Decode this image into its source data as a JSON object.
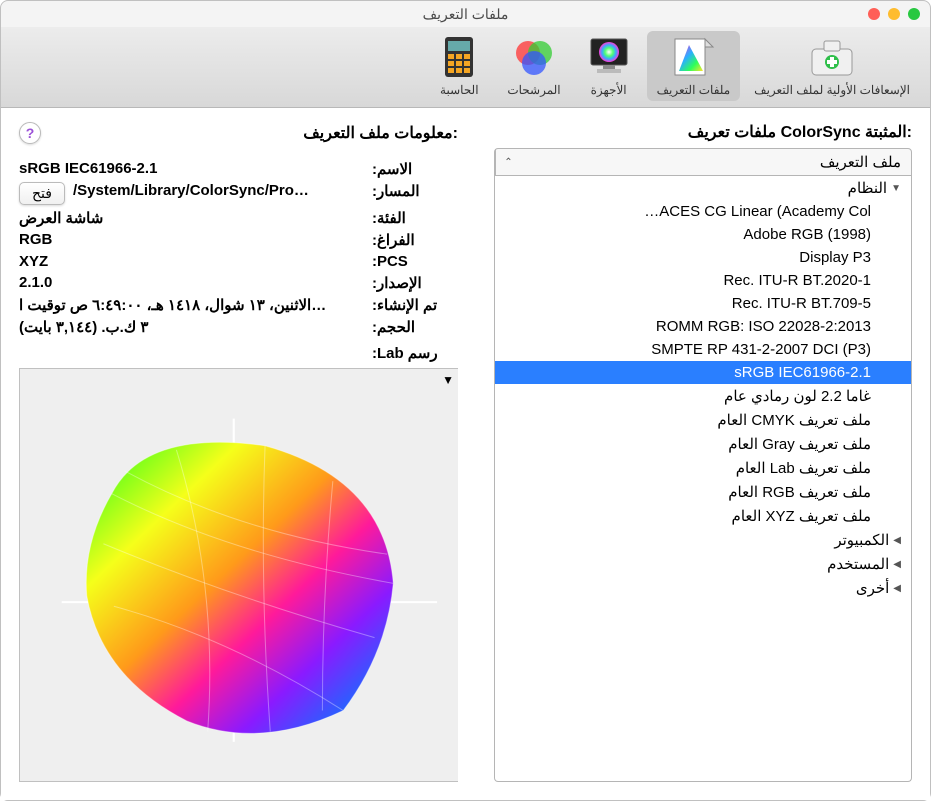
{
  "window": {
    "title": "ملفات التعريف"
  },
  "traffic": {
    "close": "#ff5f57",
    "min": "#febc2e",
    "max": "#28c840"
  },
  "toolbar": {
    "items": [
      {
        "id": "first-aid",
        "label": "الإسعافات الأولية لملف التعريف"
      },
      {
        "id": "profiles",
        "label": "ملفات التعريف",
        "selected": true
      },
      {
        "id": "devices",
        "label": "الأجهزة"
      },
      {
        "id": "filters",
        "label": "المرشحات"
      },
      {
        "id": "calculator",
        "label": "الحاسبة"
      }
    ]
  },
  "right": {
    "heading": "ملفات تعريف ColorSync المثبتة:",
    "column": "ملف التعريف",
    "groups": [
      {
        "name": "النظام",
        "expanded": true,
        "items": [
          "ACES CG Linear (Academy Col…",
          "Adobe RGB (1998)",
          "Display P3",
          "Rec. ITU-R BT.2020-1",
          "Rec. ITU-R BT.709-5",
          "ROMM RGB: ISO 22028-2:2013",
          "SMPTE RP 431-2-2007 DCI (P3)",
          "sRGB IEC61966-2.1",
          "غاما 2.2 لون رمادي عام",
          "ملف تعريف CMYK العام",
          "ملف تعريف Gray العام",
          "ملف تعريف Lab العام",
          "ملف تعريف RGB العام",
          "ملف تعريف XYZ العام"
        ],
        "selectedIndex": 7
      },
      {
        "name": "الكمبيوتر",
        "expanded": false
      },
      {
        "name": "المستخدم",
        "expanded": false
      },
      {
        "name": "أخرى",
        "expanded": false
      }
    ]
  },
  "left": {
    "heading": "معلومات ملف التعريف:",
    "open": "فتح",
    "rows": {
      "name": {
        "label": "الاسم:",
        "value": "sRGB IEC61966-2.1"
      },
      "path": {
        "label": "المسار:",
        "value": "/System/Library/ColorSync/Pro…"
      },
      "class": {
        "label": "الفئة:",
        "value": "شاشة العرض"
      },
      "space": {
        "label": "الفراغ:",
        "value": "RGB"
      },
      "pcs": {
        "label": "PCS:",
        "value": "XYZ"
      },
      "version": {
        "label": "الإصدار:",
        "value": "2.1.0"
      },
      "created": {
        "label": "تم الإنشاء:",
        "value": "الاثنين، ١٣ شوال، ١٤١٨ هـ، ٦:٤٩:٠٠ ص توقيت ا…"
      },
      "size": {
        "label": "الحجم:",
        "value": "٣ ك.ب. (٣,١٤٤ بايت)"
      }
    },
    "lab": "رسم Lab:"
  },
  "help": "?"
}
